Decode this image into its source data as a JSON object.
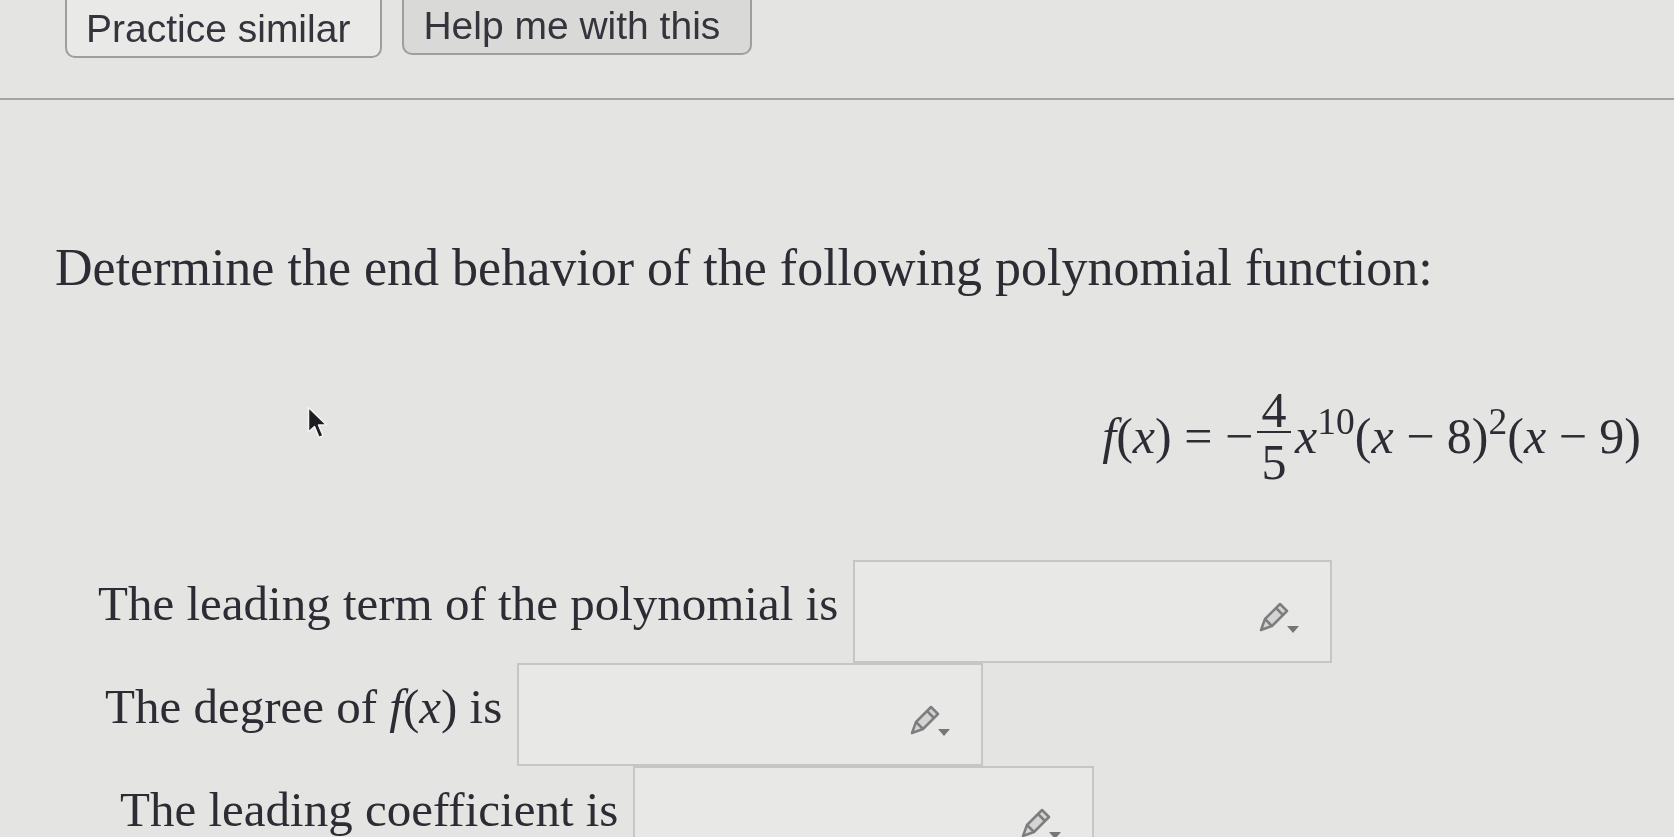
{
  "toolbar": {
    "buttons": [
      {
        "label": "Practice similar",
        "kind": "outline"
      },
      {
        "label": "Help me with this",
        "kind": "filled"
      }
    ]
  },
  "question": {
    "prompt": "Determine the end behavior of the following polynomial function:",
    "formula": {
      "lhs": "*f*(*x*) = −",
      "numerator": "4",
      "denominator": "5",
      "factors": "*x*$^{10}$(*x* − 8)$^{2}$(*x* − 9)"
    }
  },
  "answers": [
    {
      "label": "The leading term of the polynomial is"
    },
    {
      "label": "The degree of *f*(*x*) is"
    },
    {
      "label": "The leading coefficient is"
    }
  ]
}
